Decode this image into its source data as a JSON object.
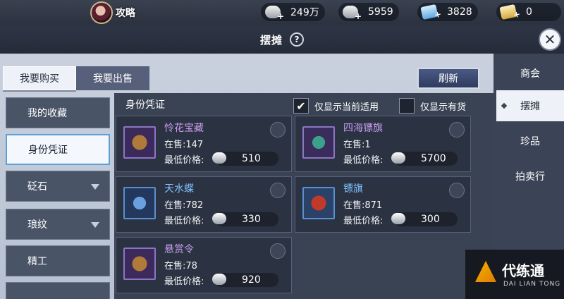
{
  "topbar": {
    "strategy_label": "攻略",
    "currencies": [
      {
        "icon": "silver-coin-icon",
        "value": "249万"
      },
      {
        "icon": "silver-ingot-icon",
        "value": "5959"
      },
      {
        "icon": "ticket-icon",
        "value": "3828"
      },
      {
        "icon": "gold-ticket-icon",
        "value": "0"
      }
    ]
  },
  "panel": {
    "title": "摆摊",
    "help": "?",
    "close": "✕"
  },
  "tabs": {
    "buy": "我要购买",
    "sell": "我要出售",
    "refresh": "刷新"
  },
  "categories": [
    {
      "label": "我的收藏"
    },
    {
      "label": "身份凭证"
    },
    {
      "label": "砭石"
    },
    {
      "label": "琅纹"
    },
    {
      "label": "精工"
    }
  ],
  "section": {
    "title": "身份凭证",
    "filter_applicable": "仅显示当前适用",
    "filter_applicable_checked": "✔",
    "filter_in_stock": "仅显示有货"
  },
  "items": [
    {
      "name": "怜花宝藏",
      "stock": "在售:147",
      "price_label": "最低价格:",
      "price": "510",
      "icon": "treasure-map-icon"
    },
    {
      "name": "四海镖旗",
      "stock": "在售:1",
      "price_label": "最低价格:",
      "price": "5700",
      "icon": "escort-flag-icon"
    },
    {
      "name": "天水蝶",
      "stock": "在售:782",
      "price_label": "最低价格:",
      "price": "330",
      "icon": "butterfly-icon"
    },
    {
      "name": "镖旗",
      "stock": "在售:871",
      "price_label": "最低价格:",
      "price": "300",
      "icon": "red-flag-icon"
    },
    {
      "name": "悬赏令",
      "stock": "在售:78",
      "price_label": "最低价格:",
      "price": "920",
      "icon": "bounty-order-icon"
    }
  ],
  "rightnav": [
    {
      "label": "商会"
    },
    {
      "label": "摆摊"
    },
    {
      "label": "珍品"
    },
    {
      "label": "拍卖行"
    }
  ],
  "watermark": {
    "text": "代练通",
    "sub": "DAI LIAN TONG"
  }
}
